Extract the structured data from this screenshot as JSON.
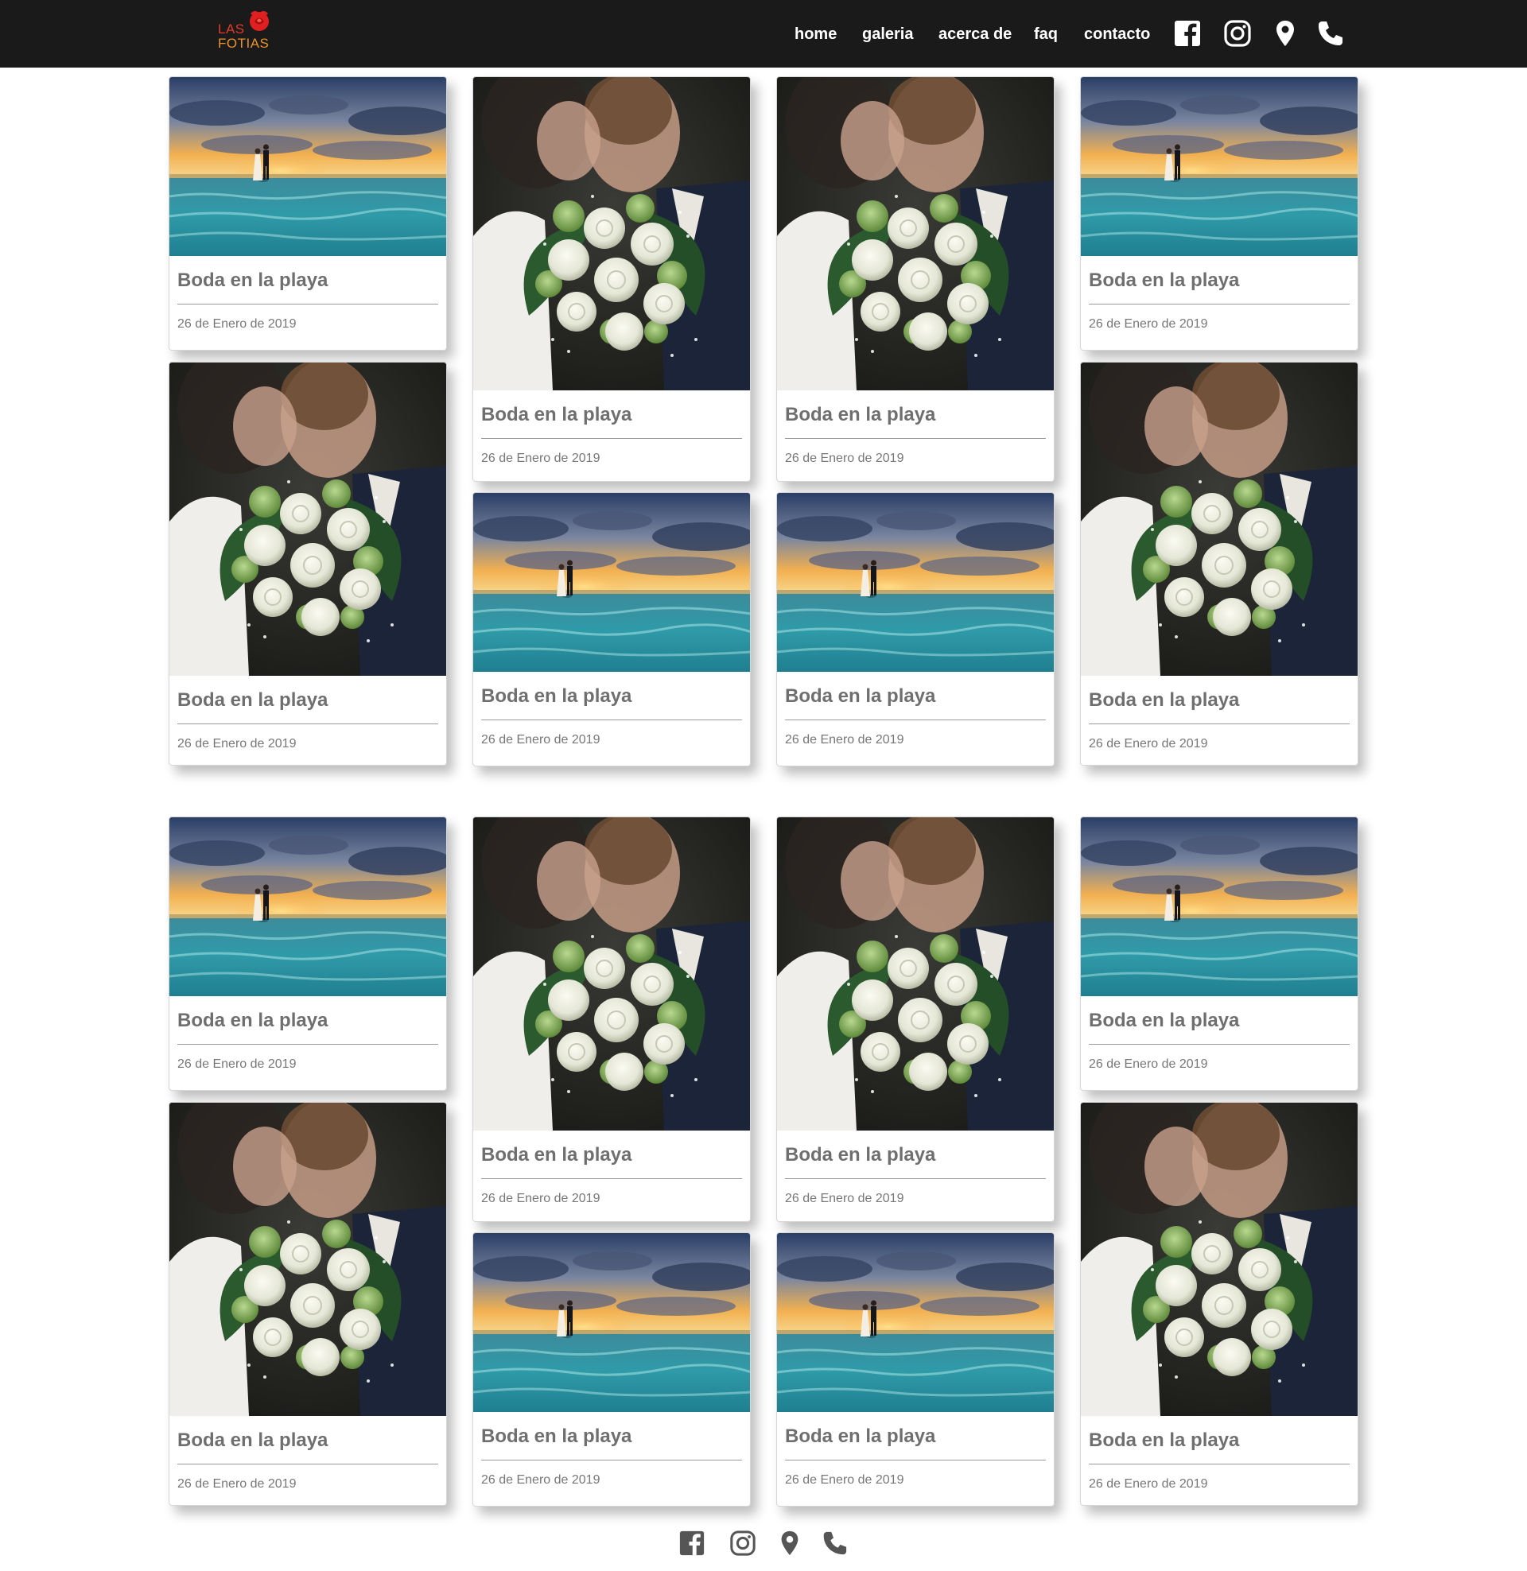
{
  "header": {
    "logo_line1": "LAS",
    "logo_line2": "FOTIAS",
    "nav": [
      {
        "label": "home"
      },
      {
        "label": "galeria"
      },
      {
        "label": "acerca de"
      },
      {
        "label": "faq"
      },
      {
        "label": "contacto"
      }
    ],
    "social_icons": [
      "facebook-icon",
      "instagram-icon",
      "location-pin-icon",
      "phone-icon"
    ]
  },
  "gallery": {
    "sections": [
      {
        "cards": [
          {
            "title": "Boda en la playa",
            "date": "26 de Enero de 2019",
            "image": "beach-couple-photo"
          },
          {
            "title": "Boda en la playa",
            "date": "26 de Enero de 2019",
            "image": "bouquet-kiss-photo"
          },
          {
            "title": "Boda en la playa",
            "date": "26 de Enero de 2019",
            "image": "bouquet-kiss-photo"
          },
          {
            "title": "Boda en la playa",
            "date": "26 de Enero de 2019",
            "image": "beach-couple-photo"
          },
          {
            "title": "Boda en la playa",
            "date": "26 de Enero de 2019",
            "image": "bouquet-kiss-photo"
          },
          {
            "title": "Boda en la playa",
            "date": "26 de Enero de 2019",
            "image": "beach-couple-photo"
          },
          {
            "title": "Boda en la playa",
            "date": "26 de Enero de 2019",
            "image": "beach-couple-photo"
          },
          {
            "title": "Boda en la playa",
            "date": "26 de Enero de 2019",
            "image": "bouquet-kiss-photo"
          }
        ]
      },
      {
        "cards": [
          {
            "title": "Boda en la playa",
            "date": "26 de Enero de 2019",
            "image": "beach-couple-photo"
          },
          {
            "title": "Boda en la playa",
            "date": "26 de Enero de 2019",
            "image": "bouquet-kiss-photo"
          },
          {
            "title": "Boda en la playa",
            "date": "26 de Enero de 2019",
            "image": "bouquet-kiss-photo"
          },
          {
            "title": "Boda en la playa",
            "date": "26 de Enero de 2019",
            "image": "beach-couple-photo"
          },
          {
            "title": "Boda en la playa",
            "date": "26 de Enero de 2019",
            "image": "bouquet-kiss-photo"
          },
          {
            "title": "Boda en la playa",
            "date": "26 de Enero de 2019",
            "image": "beach-couple-photo"
          },
          {
            "title": "Boda en la playa",
            "date": "26 de Enero de 2019",
            "image": "beach-couple-photo"
          },
          {
            "title": "Boda en la playa",
            "date": "26 de Enero de 2019",
            "image": "bouquet-kiss-photo"
          }
        ]
      }
    ]
  },
  "footer": {
    "social_icons": [
      "facebook-icon",
      "instagram-icon",
      "location-pin-icon",
      "phone-icon"
    ]
  },
  "colors": {
    "header_bg": "#1a1a1a",
    "logo_red": "#e23a2a",
    "logo_orange": "#e8912a",
    "card_text": "#6f6f6f",
    "footer_icons": "#555555"
  }
}
